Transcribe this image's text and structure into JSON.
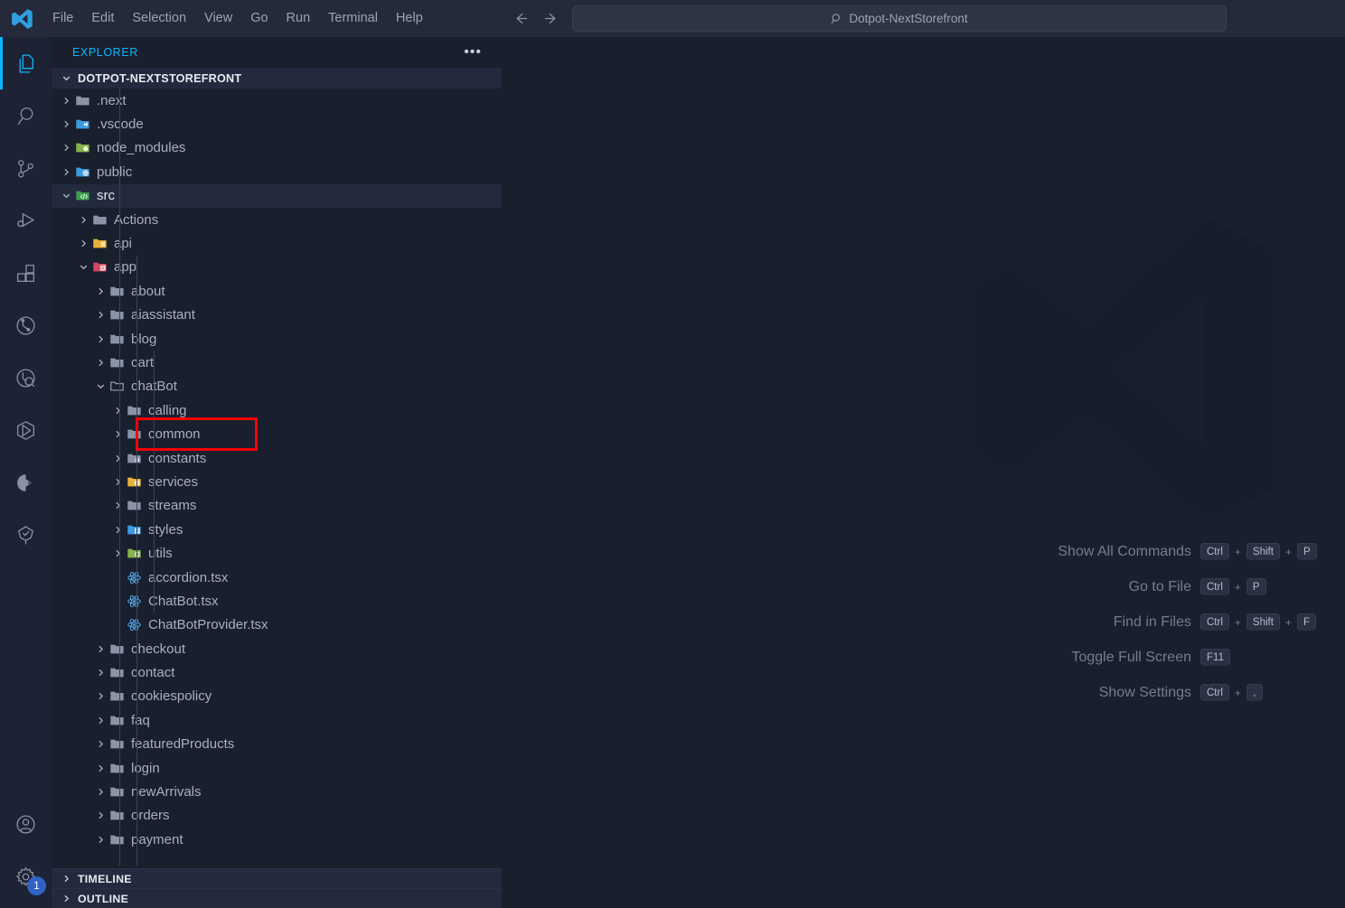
{
  "titlebar": {
    "logo_icon": "vscode-logo-icon",
    "menus": [
      "File",
      "Edit",
      "Selection",
      "View",
      "Go",
      "Run",
      "Terminal",
      "Help"
    ],
    "back_icon": "arrow-left-icon",
    "forward_icon": "arrow-right-icon",
    "search": {
      "icon": "search-icon",
      "value": "Dotpot-NextStorefront"
    }
  },
  "activitybar": {
    "items": [
      {
        "name": "explorer",
        "icon": "files-icon",
        "active": true
      },
      {
        "name": "search",
        "icon": "search-icon",
        "active": false
      },
      {
        "name": "source-control",
        "icon": "source-control-icon",
        "active": false
      },
      {
        "name": "run-and-debug",
        "icon": "run-debug-icon",
        "active": false
      },
      {
        "name": "extensions",
        "icon": "extensions-icon",
        "active": false
      },
      {
        "name": "testing",
        "icon": "beaker-icon",
        "active": false
      },
      {
        "name": "remote-explorer",
        "icon": "remote-explorer-icon",
        "active": false
      },
      {
        "name": "docker",
        "icon": "docker-icon",
        "active": false
      },
      {
        "name": "azure",
        "icon": "azure-icon",
        "active": false
      },
      {
        "name": "dependency-tree",
        "icon": "tree-check-icon",
        "active": false
      }
    ],
    "accounts": {
      "icon": "account-icon",
      "label": "Accounts"
    },
    "settings": {
      "icon": "gear-icon",
      "label": "Manage",
      "badge": "1"
    }
  },
  "sidebar": {
    "header_title": "EXPLORER",
    "more_icon": "ellipsis-icon",
    "root": {
      "label": "DOTPOT-NEXTSTOREFRONT",
      "expanded": true
    },
    "tree": [
      {
        "label": ".next",
        "depth": 1,
        "type": "folder",
        "icon": "folder-gray-icon",
        "state": "collapsed"
      },
      {
        "label": ".vscode",
        "depth": 1,
        "type": "folder",
        "icon": "folder-vscode-icon",
        "state": "collapsed"
      },
      {
        "label": "node_modules",
        "depth": 1,
        "type": "folder",
        "icon": "folder-node-icon",
        "state": "collapsed"
      },
      {
        "label": "public",
        "depth": 1,
        "type": "folder",
        "icon": "folder-public-icon",
        "state": "collapsed"
      },
      {
        "label": "src",
        "depth": 1,
        "type": "folder",
        "icon": "folder-src-icon",
        "state": "expanded",
        "selected": true
      },
      {
        "label": "Actions",
        "depth": 2,
        "type": "folder",
        "icon": "folder-gray-icon",
        "state": "collapsed"
      },
      {
        "label": "api",
        "depth": 2,
        "type": "folder",
        "icon": "folder-api-icon",
        "state": "collapsed"
      },
      {
        "label": "app",
        "depth": 2,
        "type": "folder",
        "icon": "folder-app-icon",
        "state": "expanded"
      },
      {
        "label": "about",
        "depth": 3,
        "type": "folder",
        "icon": "folder-gray-icon",
        "state": "collapsed"
      },
      {
        "label": "aiassistant",
        "depth": 3,
        "type": "folder",
        "icon": "folder-gray-icon",
        "state": "collapsed"
      },
      {
        "label": "blog",
        "depth": 3,
        "type": "folder",
        "icon": "folder-gray-icon",
        "state": "collapsed"
      },
      {
        "label": "cart",
        "depth": 3,
        "type": "folder",
        "icon": "folder-gray-icon",
        "state": "collapsed"
      },
      {
        "label": "chatBot",
        "depth": 3,
        "type": "folder",
        "icon": "folder-open-gray-icon",
        "state": "expanded",
        "highlighted": true
      },
      {
        "label": "calling",
        "depth": 4,
        "type": "folder",
        "icon": "folder-gray-icon",
        "state": "collapsed"
      },
      {
        "label": "common",
        "depth": 4,
        "type": "folder",
        "icon": "folder-gray-icon",
        "state": "collapsed"
      },
      {
        "label": "constants",
        "depth": 4,
        "type": "folder",
        "icon": "folder-constants-icon",
        "state": "collapsed"
      },
      {
        "label": "services",
        "depth": 4,
        "type": "folder",
        "icon": "folder-services-icon",
        "state": "collapsed"
      },
      {
        "label": "streams",
        "depth": 4,
        "type": "folder",
        "icon": "folder-gray-icon",
        "state": "collapsed"
      },
      {
        "label": "styles",
        "depth": 4,
        "type": "folder",
        "icon": "folder-styles-icon",
        "state": "collapsed"
      },
      {
        "label": "utils",
        "depth": 4,
        "type": "folder",
        "icon": "folder-utils-icon",
        "state": "collapsed"
      },
      {
        "label": "accordion.tsx",
        "depth": 4,
        "type": "file",
        "icon": "react-icon",
        "state": "none"
      },
      {
        "label": "ChatBot.tsx",
        "depth": 4,
        "type": "file",
        "icon": "react-icon",
        "state": "none"
      },
      {
        "label": "ChatBotProvider.tsx",
        "depth": 4,
        "type": "file",
        "icon": "react-icon",
        "state": "none"
      },
      {
        "label": "checkout",
        "depth": 3,
        "type": "folder",
        "icon": "folder-gray-icon",
        "state": "collapsed"
      },
      {
        "label": "contact",
        "depth": 3,
        "type": "folder",
        "icon": "folder-gray-icon",
        "state": "collapsed"
      },
      {
        "label": "cookiespolicy",
        "depth": 3,
        "type": "folder",
        "icon": "folder-gray-icon",
        "state": "collapsed"
      },
      {
        "label": "faq",
        "depth": 3,
        "type": "folder",
        "icon": "folder-gray-icon",
        "state": "collapsed"
      },
      {
        "label": "featuredProducts",
        "depth": 3,
        "type": "folder",
        "icon": "folder-gray-icon",
        "state": "collapsed"
      },
      {
        "label": "login",
        "depth": 3,
        "type": "folder",
        "icon": "folder-gray-icon",
        "state": "collapsed"
      },
      {
        "label": "newArrivals",
        "depth": 3,
        "type": "folder",
        "icon": "folder-gray-icon",
        "state": "collapsed"
      },
      {
        "label": "orders",
        "depth": 3,
        "type": "folder",
        "icon": "folder-gray-icon",
        "state": "collapsed"
      },
      {
        "label": "payment",
        "depth": 3,
        "type": "folder",
        "icon": "folder-gray-icon",
        "state": "collapsed"
      }
    ],
    "panes": [
      {
        "label": "TIMELINE",
        "expanded": false
      },
      {
        "label": "OUTLINE",
        "expanded": false
      }
    ]
  },
  "editor": {
    "watermark_icon": "vscode-watermark-icon",
    "shortcuts": [
      {
        "label": "Show All Commands",
        "keys": [
          "Ctrl",
          "Shift",
          "P"
        ]
      },
      {
        "label": "Go to File",
        "keys": [
          "Ctrl",
          "P"
        ]
      },
      {
        "label": "Find in Files",
        "keys": [
          "Ctrl",
          "Shift",
          "F"
        ]
      },
      {
        "label": "Toggle Full Screen",
        "keys": [
          "F11"
        ]
      },
      {
        "label": "Show Settings",
        "keys": [
          "Ctrl",
          ","
        ]
      }
    ]
  },
  "colors": {
    "accent": "#0db7ff",
    "highlight_box": "#fb0007",
    "titlebar_bg": "#252a3a",
    "sidebar_bg": "#1a1f2e",
    "activitybar_bg": "#1d2234",
    "badge_bg": "#2f62c4"
  }
}
